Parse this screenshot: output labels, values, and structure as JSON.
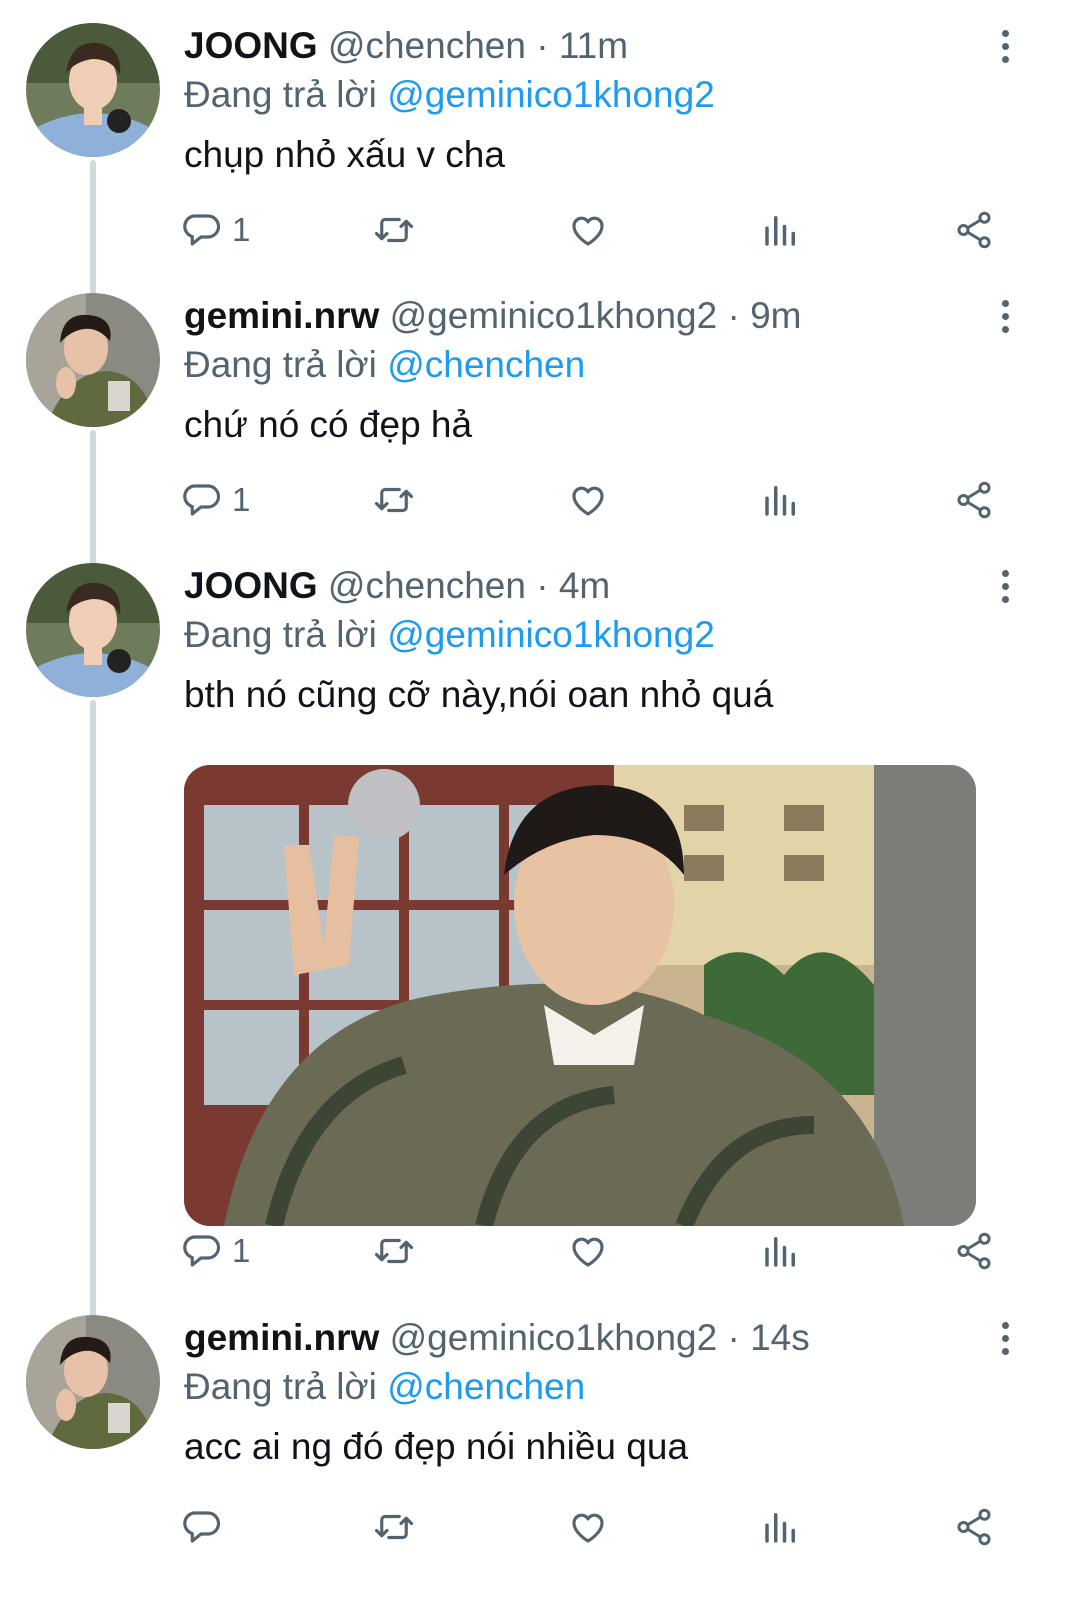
{
  "reply_prefix": "Đang trả lời",
  "tweets": [
    {
      "name": "JOONG",
      "handle": "@chenchen",
      "dot": "·",
      "time": "11m",
      "reply_to": "@geminico1khong2",
      "text": "chụp nhỏ xấu v cha",
      "replies": "1",
      "avatar": "joong-avatar"
    },
    {
      "name": "gemini.nrw",
      "handle": "@geminico1khong2",
      "dot": "·",
      "time": "9m",
      "reply_to": "@chenchen",
      "text": "chứ nó có đẹp hả",
      "replies": "1",
      "avatar": "gemini-avatar"
    },
    {
      "name": "JOONG",
      "handle": "@chenchen",
      "dot": "·",
      "time": "4m",
      "reply_to": "@geminico1khong2",
      "text": "bth nó cũng cỡ này,nói oan nhỏ quá",
      "replies": "1",
      "avatar": "joong-avatar",
      "has_photo": true
    },
    {
      "name": "gemini.nrw",
      "handle": "@geminico1khong2",
      "dot": "·",
      "time": "14s",
      "reply_to": "@chenchen",
      "text": "acc ai ng đó đẹp nói nhiều qua",
      "replies": "",
      "avatar": "gemini-avatar"
    }
  ],
  "colors": {
    "name": "#0f1419",
    "secondary": "#536471",
    "mention": "#1d9bf0",
    "thread_line": "#cfd9de"
  },
  "icons": [
    "reply-icon",
    "retweet-icon",
    "like-icon",
    "views-icon",
    "share-icon",
    "more-icon"
  ]
}
